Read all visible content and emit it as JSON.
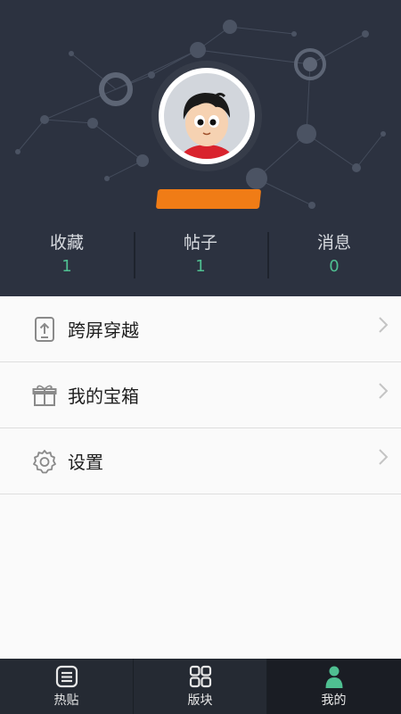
{
  "profile": {
    "stats": [
      {
        "label": "收藏",
        "value": "1"
      },
      {
        "label": "帖子",
        "value": "1"
      },
      {
        "label": "消息",
        "value": "0"
      }
    ]
  },
  "menu": {
    "items": [
      {
        "label": "跨屏穿越",
        "icon": "cross-screen-icon"
      },
      {
        "label": "我的宝箱",
        "icon": "gift-box-icon"
      },
      {
        "label": "设置",
        "icon": "settings-gear-icon"
      }
    ]
  },
  "tabs": [
    {
      "label": "热贴",
      "icon": "list-icon",
      "active": false
    },
    {
      "label": "版块",
      "icon": "grid-icon",
      "active": false
    },
    {
      "label": "我的",
      "icon": "person-icon",
      "active": true
    }
  ],
  "colors": {
    "header_bg": "#2c3240",
    "accent_green": "#4fbf91",
    "username_mask": "#f07c16",
    "tabbar_bg": "#252a33"
  }
}
